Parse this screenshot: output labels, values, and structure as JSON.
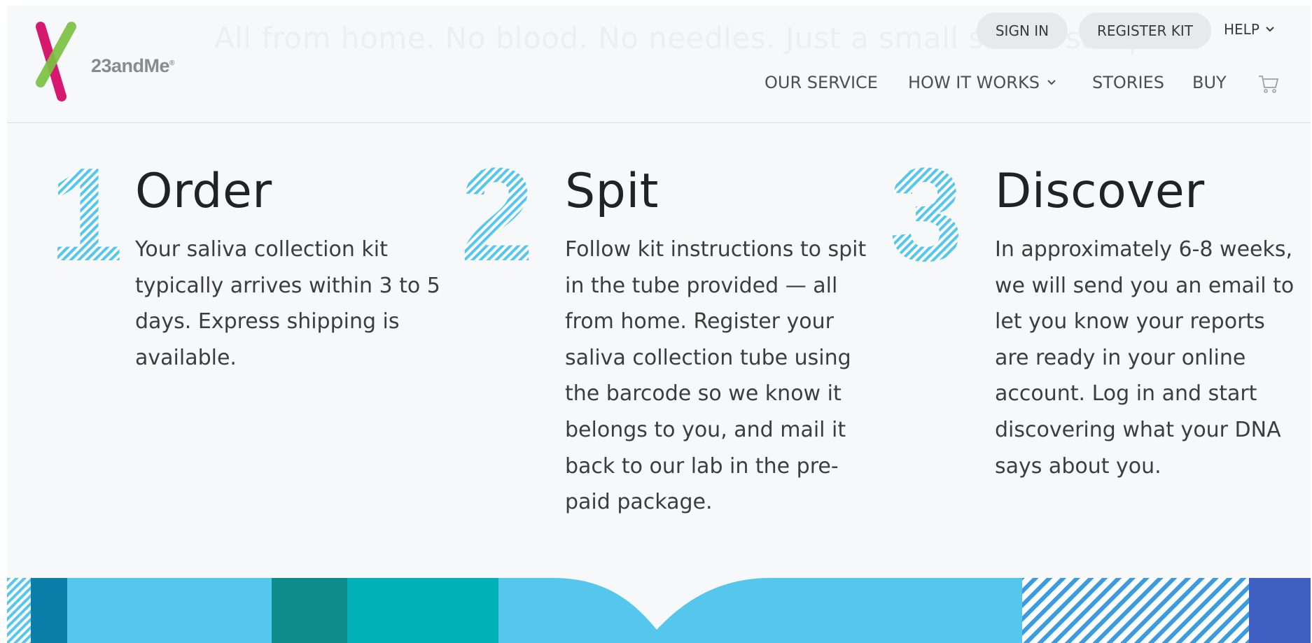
{
  "brand": {
    "name": "23andMe",
    "registered_mark": "®",
    "colors": {
      "pink": "#d6196e",
      "green": "#7cc242",
      "accent_blue": "#55c7ec"
    }
  },
  "header": {
    "ghost_text": "All from home. No blood. No needles. Just a small saliva sample.",
    "utility": {
      "sign_in": "SIGN IN",
      "register_kit": "REGISTER KIT",
      "help": "HELP"
    },
    "nav": {
      "our_service": "OUR SERVICE",
      "how_it_works": "HOW IT WORKS",
      "stories": "STORIES",
      "buy": "BUY"
    },
    "icons": [
      "chevron-down-icon",
      "cart-icon"
    ]
  },
  "steps": [
    {
      "number": "1",
      "title": "Order",
      "lines": [
        "Your saliva collection kit",
        "typically arrives within 3 to 5",
        "days. Express shipping is",
        "available."
      ]
    },
    {
      "number": "2",
      "title": "Spit",
      "lines": [
        "Follow kit instructions to spit",
        "in the tube provided — all",
        "from home. Register your",
        "saliva collection tube using",
        "the barcode so we know it",
        "belongs to you, and mail it",
        "back to our lab in the pre-",
        "paid package."
      ]
    },
    {
      "number": "3",
      "title": "Discover",
      "lines": [
        "In approximately 6-8 weeks,",
        "we will send you an email to",
        "let you know your reports",
        "are ready in your online",
        "account. Log in and start",
        "discovering what your DNA",
        "says about you."
      ]
    }
  ]
}
